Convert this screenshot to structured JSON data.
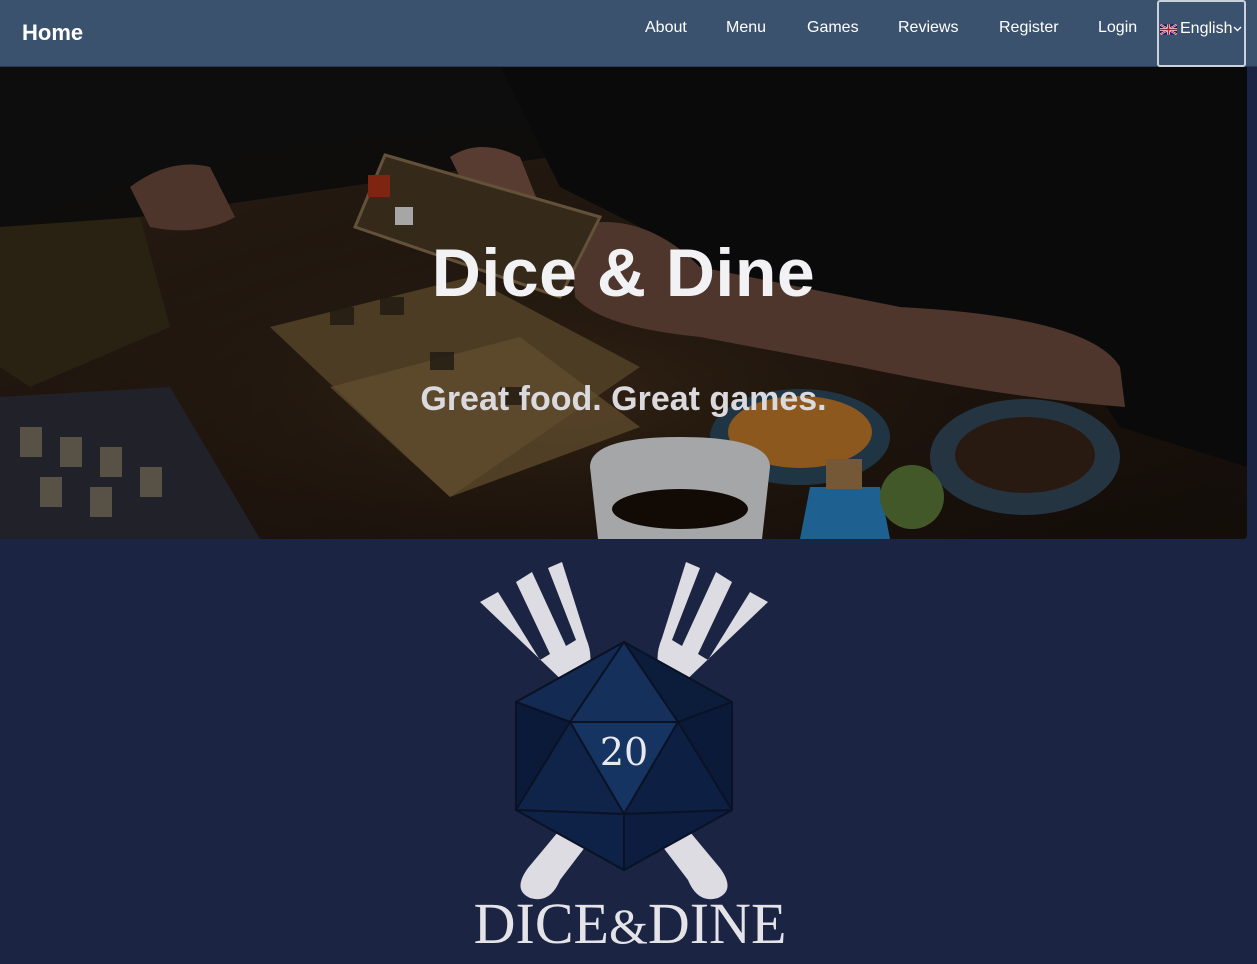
{
  "nav": {
    "brand": "Home",
    "links": [
      "About",
      "Menu",
      "Games",
      "Reviews",
      "Register",
      "Login"
    ],
    "language": {
      "label": "English",
      "flag_icon": "uk-flag-icon",
      "caret_icon": "chevron-down-icon"
    }
  },
  "hero": {
    "title": "Dice & Dine",
    "subtitle": "Great food. Great games."
  },
  "logo": {
    "die_number": "20",
    "wordmark_left": "DICE",
    "wordmark_amp": "&",
    "wordmark_right": "DINE"
  },
  "colors": {
    "navbar": "#3b526e",
    "page_background": "#1c2443",
    "die_face": "#0f2244",
    "fork": "#dcdce2"
  }
}
